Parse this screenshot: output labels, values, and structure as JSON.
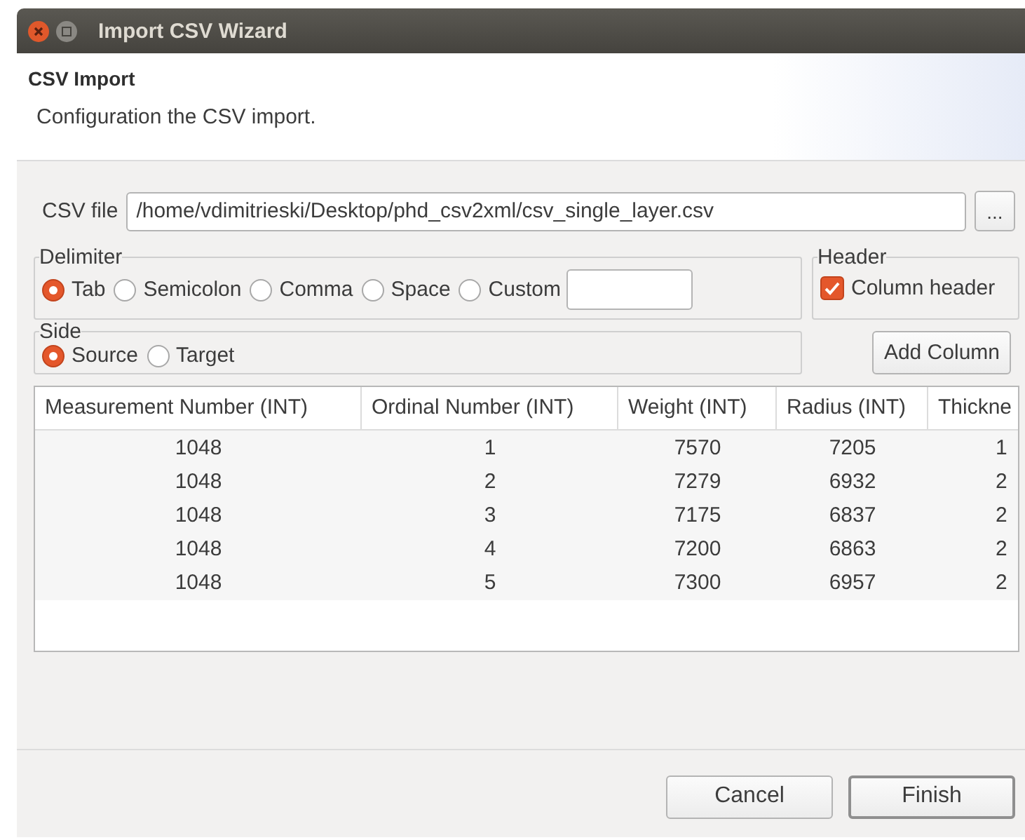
{
  "window": {
    "title": "Import CSV Wizard"
  },
  "page": {
    "title": "CSV Import",
    "description": "Configuration the CSV import."
  },
  "csv_file": {
    "label": "CSV file",
    "value": "/home/vdimitrieski/Desktop/phd_csv2xml/csv_single_layer.csv",
    "browse_button": "..."
  },
  "delimiter": {
    "label": "Delimiter",
    "options": [
      {
        "label": "Tab",
        "selected": true
      },
      {
        "label": "Semicolon",
        "selected": false
      },
      {
        "label": "Comma",
        "selected": false
      },
      {
        "label": "Space",
        "selected": false
      },
      {
        "label": "Custom",
        "selected": false
      }
    ]
  },
  "header": {
    "label": "Header",
    "column_header": {
      "label": "Column header",
      "checked": true
    }
  },
  "side": {
    "label": "Side",
    "options": [
      {
        "label": "Source",
        "selected": true
      },
      {
        "label": "Target",
        "selected": false
      }
    ]
  },
  "add_column_button": "Add Column",
  "table": {
    "columns": [
      "Measurement Number (INT)",
      "Ordinal Number (INT)",
      "Weight (INT)",
      "Radius (INT)",
      "Thickne"
    ],
    "rows": [
      [
        "1048",
        "1",
        "7570",
        "7205",
        "1"
      ],
      [
        "1048",
        "2",
        "7279",
        "6932",
        "2"
      ],
      [
        "1048",
        "3",
        "7175",
        "6837",
        "2"
      ],
      [
        "1048",
        "4",
        "7200",
        "6863",
        "2"
      ],
      [
        "1048",
        "5",
        "7300",
        "6957",
        "2"
      ]
    ]
  },
  "buttons": [
    {
      "label": "Cancel",
      "default": false
    },
    {
      "label": "Finish",
      "default": true
    }
  ]
}
